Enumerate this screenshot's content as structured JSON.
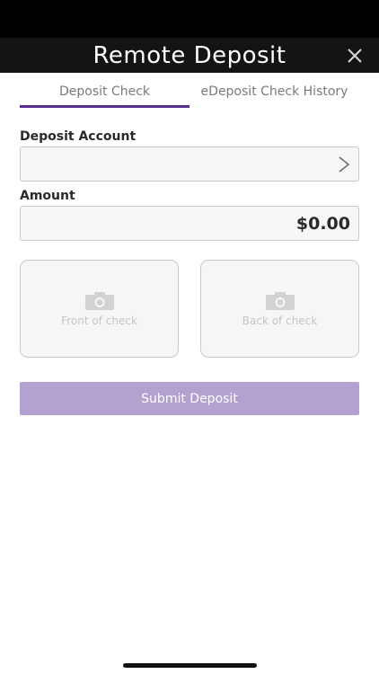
{
  "header": {
    "title": "Remote Deposit",
    "close_icon": "close-icon"
  },
  "tabs": [
    {
      "label": "Deposit Check",
      "active": true
    },
    {
      "label": "eDeposit Check History",
      "active": false
    }
  ],
  "form": {
    "account_label": "Deposit Account",
    "account_value": "",
    "amount_label": "Amount",
    "amount_value": "$0.00"
  },
  "checks": {
    "front_label": "Front of check",
    "back_label": "Back of check",
    "icon": "camera-icon"
  },
  "submit": {
    "label": "Submit Deposit"
  },
  "colors": {
    "accent": "#5a2d91",
    "submit_disabled": "#b3a1d0",
    "header_bg": "#141414"
  }
}
